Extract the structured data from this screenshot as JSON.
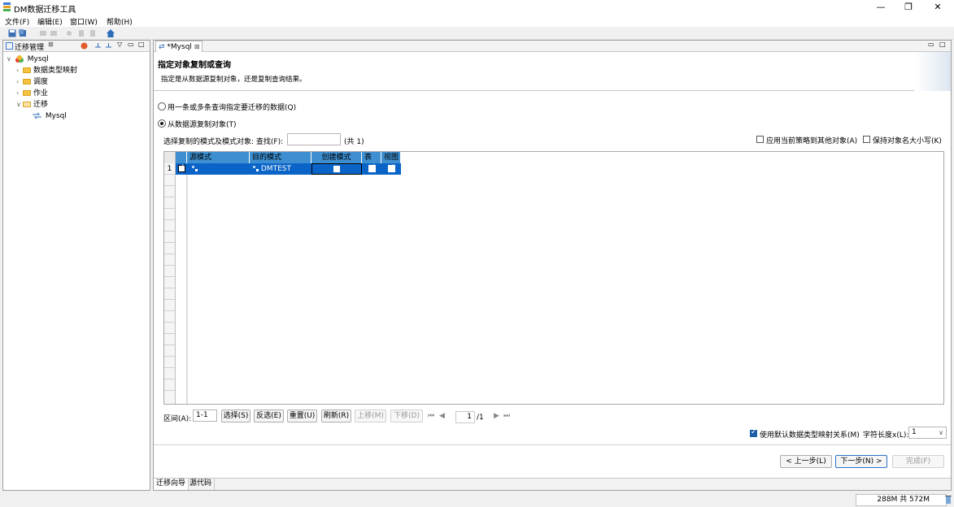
{
  "app": {
    "title": "DM数据迁移工具"
  },
  "menu": [
    "文件(F)",
    "编辑(E)",
    "窗口(W)",
    "帮助(H)"
  ],
  "left_panel": {
    "tab_label": "迁移管理",
    "tree": {
      "root": "Mysql",
      "children": [
        "数据类型映射",
        "调度",
        "作业",
        "迁移"
      ],
      "migration_child": "Mysql"
    }
  },
  "editor": {
    "tab_label": "*Mysql",
    "wizard_title": "指定对象复制或查询",
    "wizard_desc": "指定是从数据源复制对象，还是复制查询结果。",
    "option_query": "用一条或多条查询指定要迁移的数据(Q)",
    "option_copy": "从数据源复制对象(T)",
    "select_label": "选择复制的模式及模式对象:  查找(F):",
    "find_value": "",
    "count_label": "(共 1)",
    "apply_policy": "应用当前策略到其他对象(A)",
    "keep_case": "保持对象名大小写(K)",
    "grid": {
      "headers": [
        "源模式",
        "目的模式",
        "创建模式",
        "表",
        "视图"
      ],
      "rows": [
        {
          "num": "1",
          "source": "",
          "target": "DMTEST",
          "create": false,
          "table": true,
          "view": true,
          "selected": true
        }
      ]
    },
    "range_label": "区间(A):",
    "range_value": "1-1",
    "buttons": {
      "select": "选择(S)",
      "invert": "反选(E)",
      "reset": "重置(U)",
      "refresh": "刷新(R)",
      "up": "上移(M)",
      "down": "下移(D)"
    },
    "page_current": "1",
    "page_total": "/1",
    "default_mapping": "使用默认数据类型映射关系(M)",
    "char_len_label": "字符长度x(L):",
    "char_len_value": "1",
    "nav": {
      "prev": "< 上一步(L)",
      "next": "下一步(N) >",
      "finish": "完成(F)"
    },
    "bottom_tabs": [
      "迁移向导",
      "源代码"
    ]
  },
  "status": {
    "memory": "288M 共 572M"
  },
  "colors": {
    "selection": "#0a64c8",
    "header": "#3d8fd1",
    "accent": "#1e5ea8"
  }
}
